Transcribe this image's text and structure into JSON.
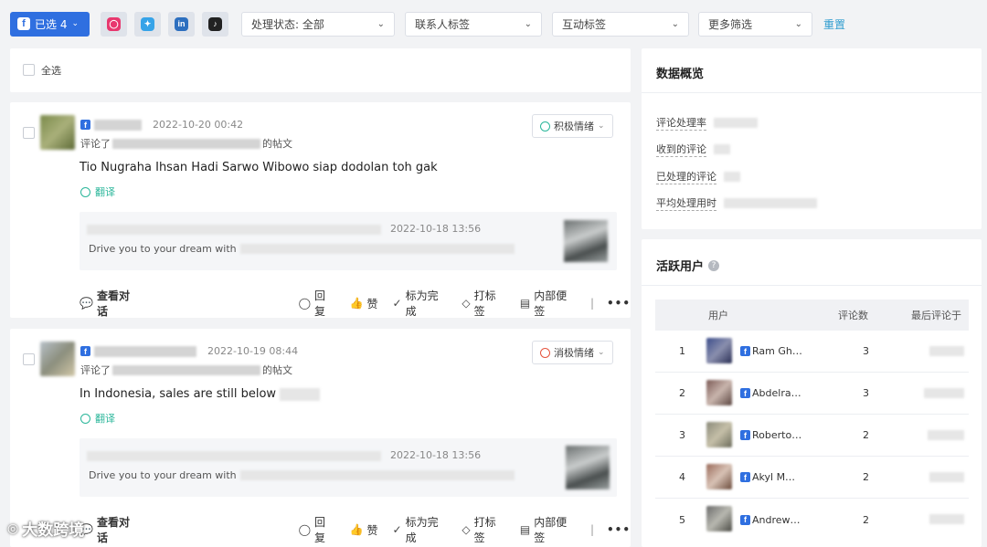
{
  "filters": {
    "selected_label": "已选 4",
    "status_label": "处理状态:",
    "status_value": "全部",
    "contact_tag": "联系人标签",
    "interaction_tag": "互动标签",
    "more_filters": "更多筛选",
    "reset": "重置",
    "platforms": [
      "instagram-icon",
      "twitter-icon",
      "linkedin-icon",
      "tiktok-icon"
    ]
  },
  "select_all": "全选",
  "comments": [
    {
      "timestamp": "2022-10-20 00:42",
      "commented_prefix": "评论了",
      "commented_suffix": "的帖文",
      "text": "Tio Nugraha Ihsan Hadi Sarwo Wibowo siap dodolan toh gak",
      "translate": "翻译",
      "sentiment": "积极情绪",
      "sentiment_color": "#2ab69a",
      "quote_time": "2022-10-18 13:56",
      "quote_text": "Drive you to your dream with",
      "actions": {
        "view": "查看对话",
        "reply": "回复",
        "like": "赞",
        "done": "标为完成",
        "tag": "打标签",
        "note": "内部便签"
      }
    },
    {
      "timestamp": "2022-10-19 08:44",
      "commented_prefix": "评论了",
      "commented_suffix": "的帖文",
      "text": "In Indonesia, sales are still below",
      "translate": "翻译",
      "sentiment": "消极情绪",
      "sentiment_color": "#e5533d",
      "quote_time": "2022-10-18 13:56",
      "quote_text": "Drive you to your dream with",
      "actions": {
        "view": "查看对话",
        "reply": "回复",
        "like": "赞",
        "done": "标为完成",
        "tag": "打标签",
        "note": "内部便签"
      }
    }
  ],
  "overview": {
    "title": "数据概览",
    "rows": [
      "评论处理率",
      "收到的评论",
      "已处理的评论",
      "平均处理用时"
    ]
  },
  "active_users": {
    "title": "活跃用户",
    "headers": {
      "user": "用户",
      "count": "评论数",
      "last": "最后评论于"
    },
    "rows": [
      {
        "rank": "1",
        "name": "Ram Gh…",
        "count": "3"
      },
      {
        "rank": "2",
        "name": "Abdelra…",
        "count": "3"
      },
      {
        "rank": "3",
        "name": "Roberto…",
        "count": "2"
      },
      {
        "rank": "4",
        "name": "Akyl M…",
        "count": "2"
      },
      {
        "rank": "5",
        "name": "Andrew…",
        "count": "2"
      }
    ]
  },
  "watermark": "大数跨境"
}
